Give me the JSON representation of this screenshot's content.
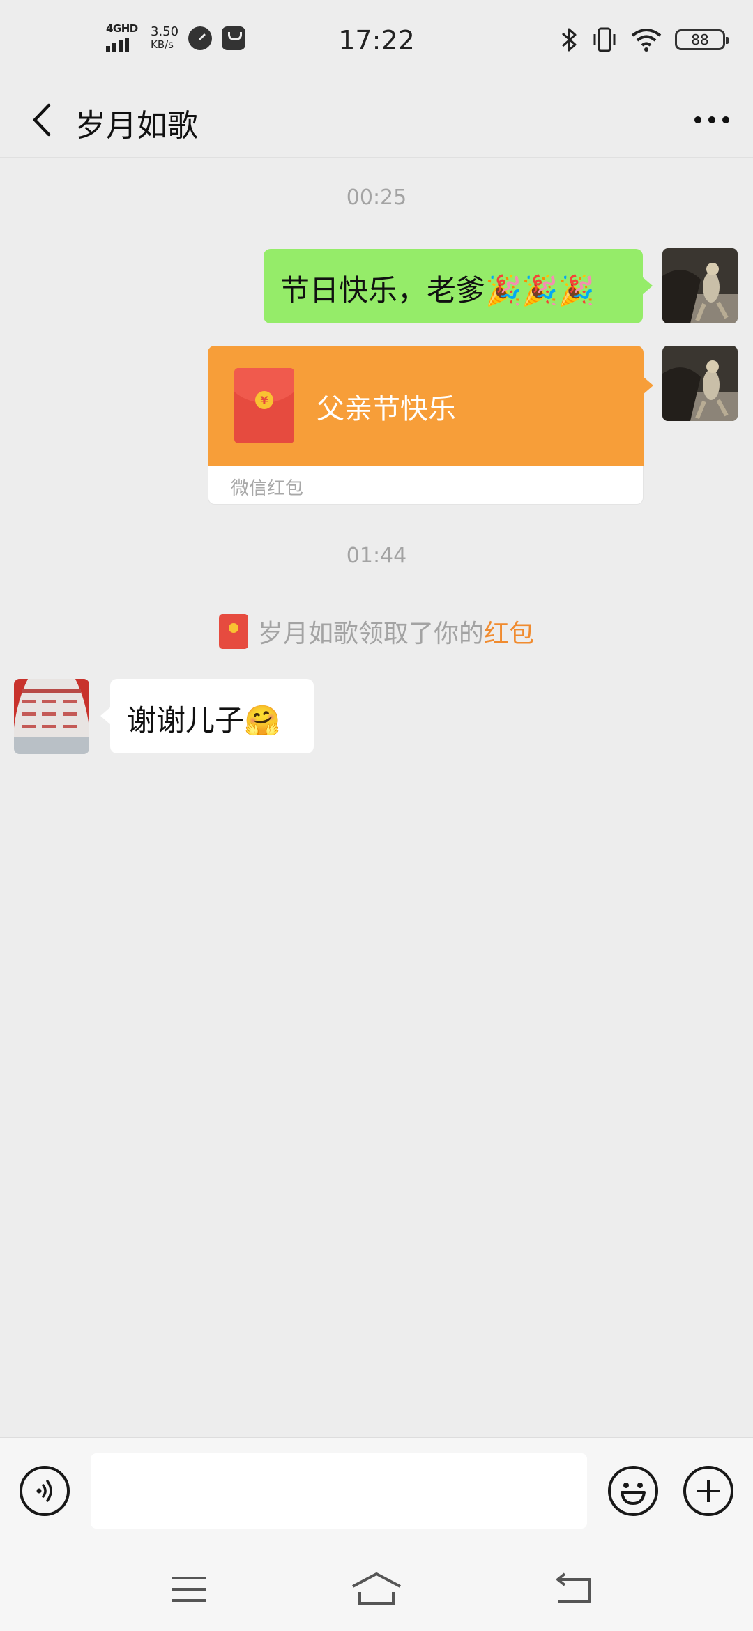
{
  "status_bar": {
    "network": "4GHD",
    "speed_value": "3.50",
    "speed_unit": "KB/s",
    "time": "17:22",
    "battery": "88"
  },
  "header": {
    "title": "岁月如歌"
  },
  "messages": [
    {
      "type": "timestamp",
      "text": "00:25"
    },
    {
      "type": "text",
      "side": "right",
      "text": "节日快乐，老爹🎉🎉🎉"
    },
    {
      "type": "red_packet",
      "side": "right",
      "title": "父亲节快乐",
      "label": "微信红包"
    },
    {
      "type": "timestamp",
      "text": "01:44"
    },
    {
      "type": "system",
      "prefix": "岁月如歌领取了你的",
      "link": "红包"
    },
    {
      "type": "text",
      "side": "left",
      "text": "谢谢儿子🤗"
    }
  ],
  "input_bar": {
    "value": "",
    "icons": [
      "voice-icon",
      "emoji-icon",
      "plus-icon"
    ]
  },
  "nav_bar": {
    "icons": [
      "menu-icon",
      "home-icon",
      "back-icon"
    ]
  },
  "colors": {
    "background": "#EDEDED",
    "bubble_self": "#95EC69",
    "red_packet": "#F79E39",
    "link": "#F08B2F"
  }
}
